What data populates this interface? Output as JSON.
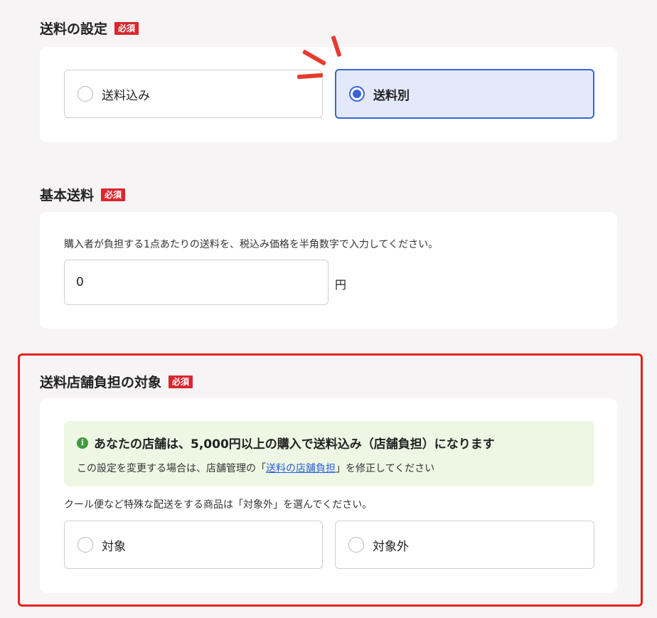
{
  "required_badge": "必須",
  "shipping_setting": {
    "title": "送料の設定",
    "options": [
      {
        "label": "送料込み",
        "selected": false
      },
      {
        "label": "送料別",
        "selected": true
      }
    ]
  },
  "base_shipping": {
    "title": "基本送料",
    "description": "購入者が負担する1点あたりの送料を、税込み価格を半角数字で入力してください。",
    "value": "0",
    "unit": "円"
  },
  "store_burden": {
    "title": "送料店舗負担の対象",
    "info_icon": "info-icon",
    "info_title": "あなたの店舗は、5,000円以上の購入で送料込み（店舗負担）になります",
    "info_note_before": "この設定を変更する場合は、店舗管理の「",
    "info_note_link": "送料の店舗負担",
    "info_note_after": "」を修正してください",
    "description": "クール便など特殊な配送をする商品は「対象外」を選んでください。",
    "options": [
      {
        "label": "対象",
        "selected": false
      },
      {
        "label": "対象外",
        "selected": false
      }
    ]
  },
  "colors": {
    "accent": "#3a63d6",
    "required": "#d9272e",
    "highlight": "#e3221c",
    "info_bg": "#eef7e4"
  }
}
